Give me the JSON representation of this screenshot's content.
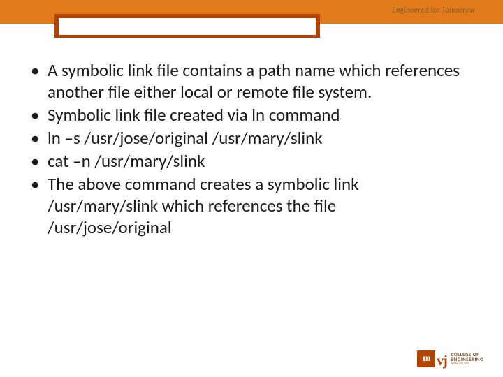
{
  "header": {
    "tagline": "Engineered for Tomorrow"
  },
  "bullets": [
    "A symbolic link file contains a path name which references another file either local or remote file system.",
    "Symbolic link file created via ln command",
    "ln –s /usr/jose/original   /usr/mary/slink",
    "cat –n /usr/mary/slink",
    "The above command creates a symbolic link /usr/mary/slink which references the file /usr/jose/original"
  ],
  "logo": {
    "mark": "m",
    "mark2": "vj",
    "line1": "COLLEGE OF",
    "line2": "ENGINEERING",
    "line3": "BANGALORE"
  }
}
